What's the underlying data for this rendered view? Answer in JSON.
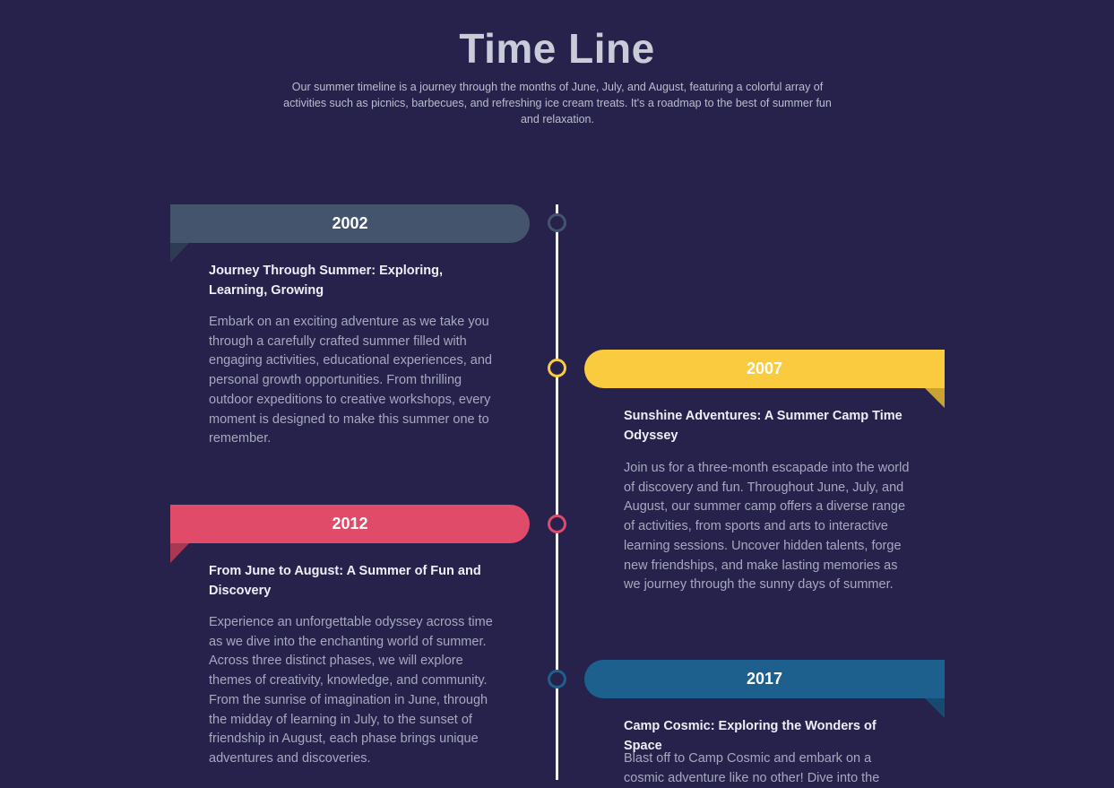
{
  "header": {
    "title": "Time Line",
    "subtitle": "Our summer timeline is a journey through the months of June, July, and August, featuring a colorful array of activities such as picnics, barbecues, and refreshing ice cream treats. It's a roadmap to the best of summer fun and relaxation."
  },
  "colors": {
    "background": "#27224c",
    "axis": "#eef0f6",
    "slate": "#44546d",
    "slate_fold": "#2f3b52",
    "yellow": "#fbcb3f",
    "yellow_fold": "#c9a233",
    "pink": "#e14b6a",
    "pink_fold": "#a93852",
    "blue": "#1d5f8d",
    "blue_fold": "#174a6e"
  },
  "events": [
    {
      "year": "2002",
      "title": "Journey Through Summer: Exploring, Learning, Growing",
      "body": "Embark on an exciting adventure as we take you through a carefully crafted summer filled with engaging activities, educational experiences, and personal growth opportunities. From thrilling outdoor expeditions to creative workshops, every moment is designed to make this summer one to remember."
    },
    {
      "year": "2007",
      "title": "Sunshine Adventures: A Summer Camp Time Odyssey",
      "body": "Join us for a three-month escapade into the world of discovery and fun. Throughout June, July, and August, our summer camp offers a diverse range of activities, from sports and arts to interactive learning sessions. Uncover hidden talents, forge new friendships, and make lasting memories as we journey through the sunny days of summer."
    },
    {
      "year": "2012",
      "title": "From June to August: A Summer of Fun and Discovery",
      "body": "Experience an unforgettable odyssey across time as we dive into the enchanting world of summer. Across three distinct phases, we will explore themes of creativity, knowledge, and community. From the sunrise of imagination in June, through the midday of learning in July, to the sunset of friendship in August, each phase brings unique adventures and discoveries."
    },
    {
      "year": "2017",
      "title": "Camp Cosmic: Exploring the Wonders of Space",
      "body": "Blast off to Camp Cosmic and embark on a cosmic adventure like no other! Dive into the"
    }
  ]
}
